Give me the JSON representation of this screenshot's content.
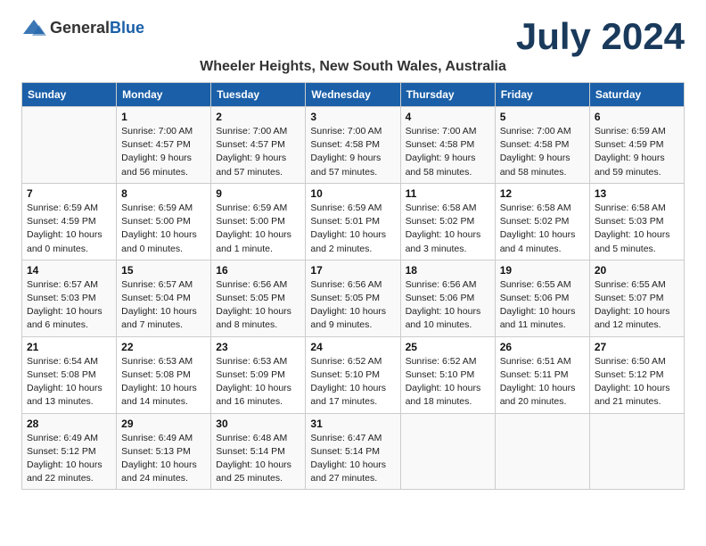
{
  "header": {
    "logo_general": "General",
    "logo_blue": "Blue",
    "month_year": "July 2024",
    "location": "Wheeler Heights, New South Wales, Australia"
  },
  "columns": [
    "Sunday",
    "Monday",
    "Tuesday",
    "Wednesday",
    "Thursday",
    "Friday",
    "Saturday"
  ],
  "weeks": [
    [
      null,
      {
        "day": "1",
        "sunrise": "Sunrise: 7:00 AM",
        "sunset": "Sunset: 4:57 PM",
        "daylight": "Daylight: 9 hours and 56 minutes."
      },
      {
        "day": "2",
        "sunrise": "Sunrise: 7:00 AM",
        "sunset": "Sunset: 4:57 PM",
        "daylight": "Daylight: 9 hours and 57 minutes."
      },
      {
        "day": "3",
        "sunrise": "Sunrise: 7:00 AM",
        "sunset": "Sunset: 4:58 PM",
        "daylight": "Daylight: 9 hours and 57 minutes."
      },
      {
        "day": "4",
        "sunrise": "Sunrise: 7:00 AM",
        "sunset": "Sunset: 4:58 PM",
        "daylight": "Daylight: 9 hours and 58 minutes."
      },
      {
        "day": "5",
        "sunrise": "Sunrise: 7:00 AM",
        "sunset": "Sunset: 4:58 PM",
        "daylight": "Daylight: 9 hours and 58 minutes."
      },
      {
        "day": "6",
        "sunrise": "Sunrise: 6:59 AM",
        "sunset": "Sunset: 4:59 PM",
        "daylight": "Daylight: 9 hours and 59 minutes."
      }
    ],
    [
      {
        "day": "7",
        "sunrise": "Sunrise: 6:59 AM",
        "sunset": "Sunset: 4:59 PM",
        "daylight": "Daylight: 10 hours and 0 minutes."
      },
      {
        "day": "8",
        "sunrise": "Sunrise: 6:59 AM",
        "sunset": "Sunset: 5:00 PM",
        "daylight": "Daylight: 10 hours and 0 minutes."
      },
      {
        "day": "9",
        "sunrise": "Sunrise: 6:59 AM",
        "sunset": "Sunset: 5:00 PM",
        "daylight": "Daylight: 10 hours and 1 minute."
      },
      {
        "day": "10",
        "sunrise": "Sunrise: 6:59 AM",
        "sunset": "Sunset: 5:01 PM",
        "daylight": "Daylight: 10 hours and 2 minutes."
      },
      {
        "day": "11",
        "sunrise": "Sunrise: 6:58 AM",
        "sunset": "Sunset: 5:02 PM",
        "daylight": "Daylight: 10 hours and 3 minutes."
      },
      {
        "day": "12",
        "sunrise": "Sunrise: 6:58 AM",
        "sunset": "Sunset: 5:02 PM",
        "daylight": "Daylight: 10 hours and 4 minutes."
      },
      {
        "day": "13",
        "sunrise": "Sunrise: 6:58 AM",
        "sunset": "Sunset: 5:03 PM",
        "daylight": "Daylight: 10 hours and 5 minutes."
      }
    ],
    [
      {
        "day": "14",
        "sunrise": "Sunrise: 6:57 AM",
        "sunset": "Sunset: 5:03 PM",
        "daylight": "Daylight: 10 hours and 6 minutes."
      },
      {
        "day": "15",
        "sunrise": "Sunrise: 6:57 AM",
        "sunset": "Sunset: 5:04 PM",
        "daylight": "Daylight: 10 hours and 7 minutes."
      },
      {
        "day": "16",
        "sunrise": "Sunrise: 6:56 AM",
        "sunset": "Sunset: 5:05 PM",
        "daylight": "Daylight: 10 hours and 8 minutes."
      },
      {
        "day": "17",
        "sunrise": "Sunrise: 6:56 AM",
        "sunset": "Sunset: 5:05 PM",
        "daylight": "Daylight: 10 hours and 9 minutes."
      },
      {
        "day": "18",
        "sunrise": "Sunrise: 6:56 AM",
        "sunset": "Sunset: 5:06 PM",
        "daylight": "Daylight: 10 hours and 10 minutes."
      },
      {
        "day": "19",
        "sunrise": "Sunrise: 6:55 AM",
        "sunset": "Sunset: 5:06 PM",
        "daylight": "Daylight: 10 hours and 11 minutes."
      },
      {
        "day": "20",
        "sunrise": "Sunrise: 6:55 AM",
        "sunset": "Sunset: 5:07 PM",
        "daylight": "Daylight: 10 hours and 12 minutes."
      }
    ],
    [
      {
        "day": "21",
        "sunrise": "Sunrise: 6:54 AM",
        "sunset": "Sunset: 5:08 PM",
        "daylight": "Daylight: 10 hours and 13 minutes."
      },
      {
        "day": "22",
        "sunrise": "Sunrise: 6:53 AM",
        "sunset": "Sunset: 5:08 PM",
        "daylight": "Daylight: 10 hours and 14 minutes."
      },
      {
        "day": "23",
        "sunrise": "Sunrise: 6:53 AM",
        "sunset": "Sunset: 5:09 PM",
        "daylight": "Daylight: 10 hours and 16 minutes."
      },
      {
        "day": "24",
        "sunrise": "Sunrise: 6:52 AM",
        "sunset": "Sunset: 5:10 PM",
        "daylight": "Daylight: 10 hours and 17 minutes."
      },
      {
        "day": "25",
        "sunrise": "Sunrise: 6:52 AM",
        "sunset": "Sunset: 5:10 PM",
        "daylight": "Daylight: 10 hours and 18 minutes."
      },
      {
        "day": "26",
        "sunrise": "Sunrise: 6:51 AM",
        "sunset": "Sunset: 5:11 PM",
        "daylight": "Daylight: 10 hours and 20 minutes."
      },
      {
        "day": "27",
        "sunrise": "Sunrise: 6:50 AM",
        "sunset": "Sunset: 5:12 PM",
        "daylight": "Daylight: 10 hours and 21 minutes."
      }
    ],
    [
      {
        "day": "28",
        "sunrise": "Sunrise: 6:49 AM",
        "sunset": "Sunset: 5:12 PM",
        "daylight": "Daylight: 10 hours and 22 minutes."
      },
      {
        "day": "29",
        "sunrise": "Sunrise: 6:49 AM",
        "sunset": "Sunset: 5:13 PM",
        "daylight": "Daylight: 10 hours and 24 minutes."
      },
      {
        "day": "30",
        "sunrise": "Sunrise: 6:48 AM",
        "sunset": "Sunset: 5:14 PM",
        "daylight": "Daylight: 10 hours and 25 minutes."
      },
      {
        "day": "31",
        "sunrise": "Sunrise: 6:47 AM",
        "sunset": "Sunset: 5:14 PM",
        "daylight": "Daylight: 10 hours and 27 minutes."
      },
      null,
      null,
      null
    ]
  ]
}
